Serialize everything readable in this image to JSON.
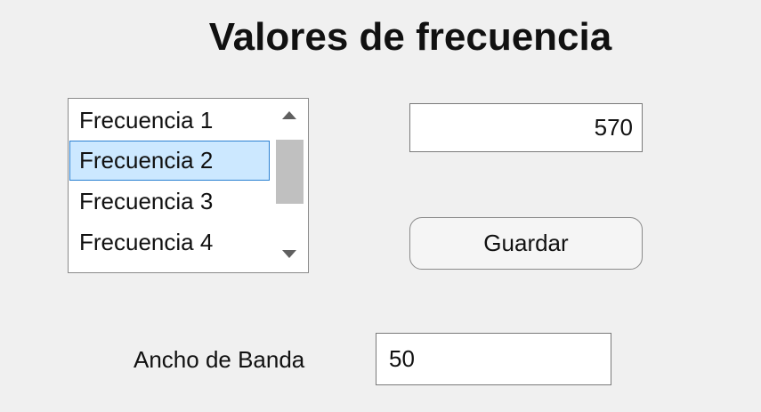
{
  "window": {
    "title": "Valores de frecuencia"
  },
  "frequency_list": {
    "items": [
      {
        "label": "Frecuencia 1",
        "selected": false
      },
      {
        "label": "Frecuencia 2",
        "selected": true
      },
      {
        "label": "Frecuencia 3",
        "selected": false
      },
      {
        "label": "Frecuencia 4",
        "selected": false
      }
    ],
    "selected_index": 1
  },
  "frequency_value": {
    "value": "570"
  },
  "save_button": {
    "label": "Guardar"
  },
  "bandwidth": {
    "label": "Ancho de Banda",
    "value": "50"
  },
  "colors": {
    "background": "#f0f0f0",
    "selection_fill": "#cce8ff",
    "selection_border": "#2a80d2",
    "scroll_thumb": "#c0c0c0"
  },
  "icons": {
    "scroll_up": "arrow-up-icon",
    "scroll_down": "arrow-down-icon"
  }
}
